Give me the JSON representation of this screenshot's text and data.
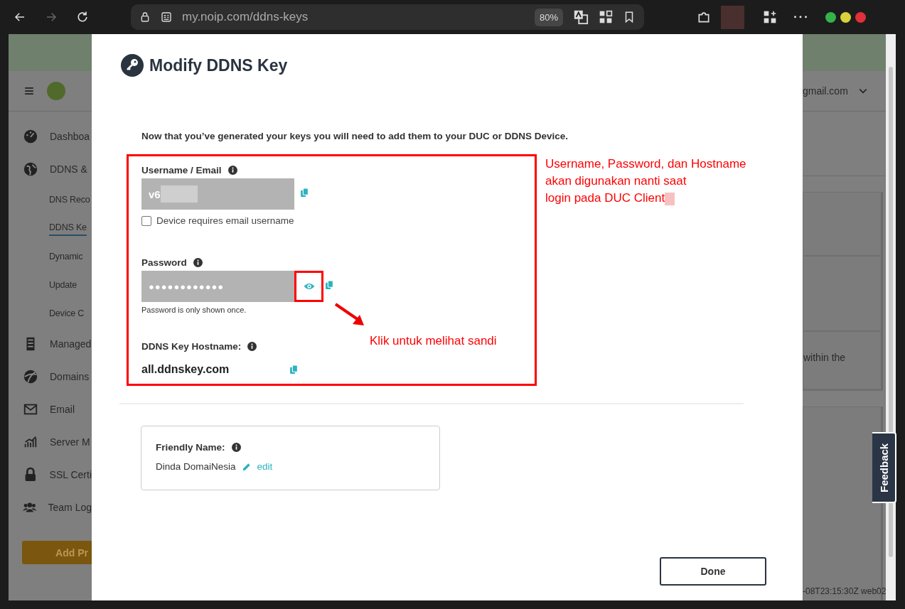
{
  "browser": {
    "url": "my.noip.com/ddns-keys",
    "zoom": "80%",
    "forward_disabled": true
  },
  "background": {
    "sidebar": [
      {
        "label": "Dashboa",
        "kind": "main",
        "selected": false
      },
      {
        "label": "DDNS &",
        "kind": "main",
        "selected": false
      },
      {
        "label": "DNS Reco",
        "kind": "sub",
        "selected": false
      },
      {
        "label": "DDNS Ke",
        "kind": "sub",
        "selected": true
      },
      {
        "label": "Dynamic",
        "kind": "sub",
        "selected": false
      },
      {
        "label": "Update",
        "kind": "sub",
        "selected": false
      },
      {
        "label": "Device C",
        "kind": "sub",
        "selected": false
      },
      {
        "label": "Managed",
        "kind": "main",
        "selected": false
      },
      {
        "label": "Domains",
        "kind": "main",
        "selected": false
      },
      {
        "label": "Email",
        "kind": "main",
        "selected": false
      },
      {
        "label": "Server M",
        "kind": "main",
        "selected": false
      },
      {
        "label": "SSL Certi",
        "kind": "main",
        "selected": false
      },
      {
        "label": "Team Log",
        "kind": "main",
        "selected": false
      }
    ],
    "add_button": "Add Pr",
    "account": "gmail.com",
    "card_text": "within the",
    "footer": "-08T23:15:30Z web02"
  },
  "modal": {
    "title": "Modify DDNS Key",
    "intro": "Now that you’ve generated your keys you will need to add them to your DUC or DDNS Device.",
    "username": {
      "label": "Username / Email",
      "value": "v6"
    },
    "email_checkbox": {
      "label": "Device requires email username",
      "checked": false
    },
    "password": {
      "label": "Password",
      "value": "●●●●●●●●●●●●",
      "hint": "Password is only shown once."
    },
    "hostname": {
      "label": "DDNS Key Hostname:",
      "value": "all.ddnskey.com"
    },
    "friendly": {
      "label": "Friendly Name:",
      "value": "Dinda DomaiNesia",
      "edit": "edit"
    },
    "done": "Done"
  },
  "annotations": {
    "note_lines": [
      "Username, Password, dan Hostname",
      "akan digunakan nanti saat",
      "login pada DUC Client"
    ],
    "hint": "Klik untuk melihat sandi"
  },
  "feedback": "Feedback"
}
